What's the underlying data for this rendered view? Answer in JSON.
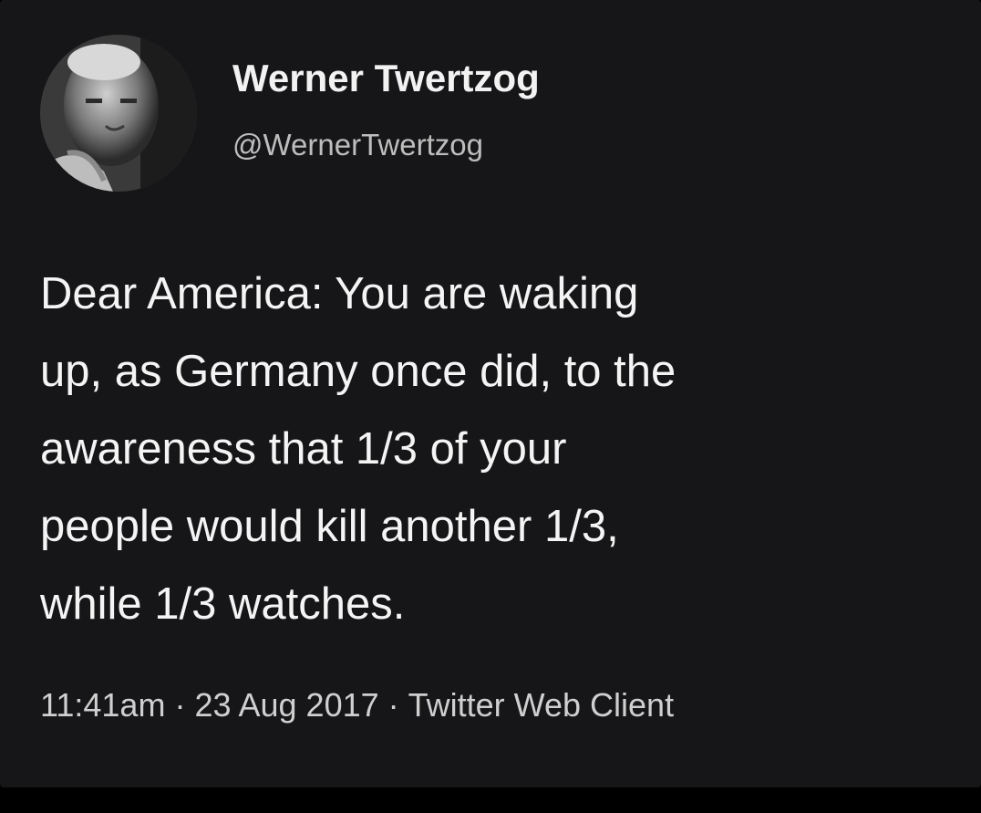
{
  "user": {
    "display_name": "Werner Twertzog",
    "handle": "@WernerTwertzog",
    "avatar_icon": "profile-photo"
  },
  "tweet": {
    "lines": [
      "Dear America: You are waking",
      "up, as Germany once did, to the",
      "awareness that 1/3 of your",
      "people would kill another 1/3,",
      "while 1/3 watches."
    ]
  },
  "meta": {
    "time": "11:41am",
    "date": "23 Aug 2017",
    "client": "Twitter Web Client",
    "separator": "·"
  },
  "colors": {
    "background": "#161618",
    "text": "#f4f4f4",
    "secondary_text": "#bdbdbd"
  }
}
